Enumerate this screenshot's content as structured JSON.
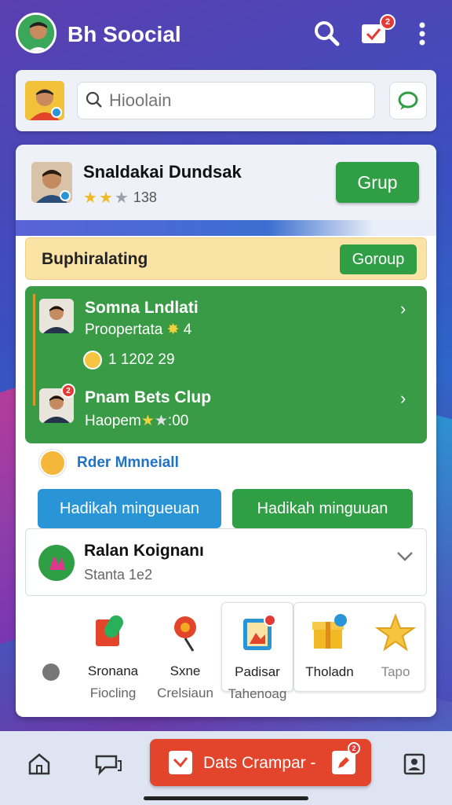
{
  "header": {
    "title": "Bh Soocial",
    "notification_count": "2"
  },
  "search": {
    "placeholder": "Hioolain"
  },
  "profile": {
    "name": "Snaldakai Dundsak",
    "rating_count": "138",
    "button_label": "Grup"
  },
  "banner": {
    "title": "Buphiralating",
    "button_label": "Goroup"
  },
  "contacts": [
    {
      "name": "Somna Lndlati",
      "sub": "Proopertata",
      "sub_suffix": "4",
      "extra": "1 1202 29"
    },
    {
      "name": "Pnam Bets Clup",
      "sub": "Haopem",
      "sub_suffix": ":00",
      "badge": "2"
    }
  ],
  "mention": {
    "label": "Rder Mmneiall"
  },
  "actions": {
    "left_label": "Hadikah mingueuan",
    "right_label": "Hadikah minguuan"
  },
  "dropdown": {
    "title": "Ralan Koignanı",
    "subtitle": "Stanta 1e2"
  },
  "tiles": [
    {
      "label": "Sronana",
      "sub": "Fiocling",
      "icon": "microphone-icon"
    },
    {
      "label": "Sxne",
      "sub": "Crelsiaun",
      "icon": "pin-icon"
    },
    {
      "label": "Padisar",
      "sub": "Tahenoag",
      "icon": "picture-frame-icon"
    },
    {
      "label": "Tholadn",
      "sub": "",
      "icon": "gift-box-icon"
    },
    {
      "label": "Tapo",
      "sub": "",
      "icon": "star-icon"
    }
  ],
  "bottom_nav": {
    "cta_label": "Dats Crampar -",
    "cta_badge": "2"
  },
  "colors": {
    "primary_green": "#2f9e44",
    "accent_blue": "#2a95d6",
    "cta_red": "#e2452b",
    "banner_yellow": "#fbe3a6"
  }
}
